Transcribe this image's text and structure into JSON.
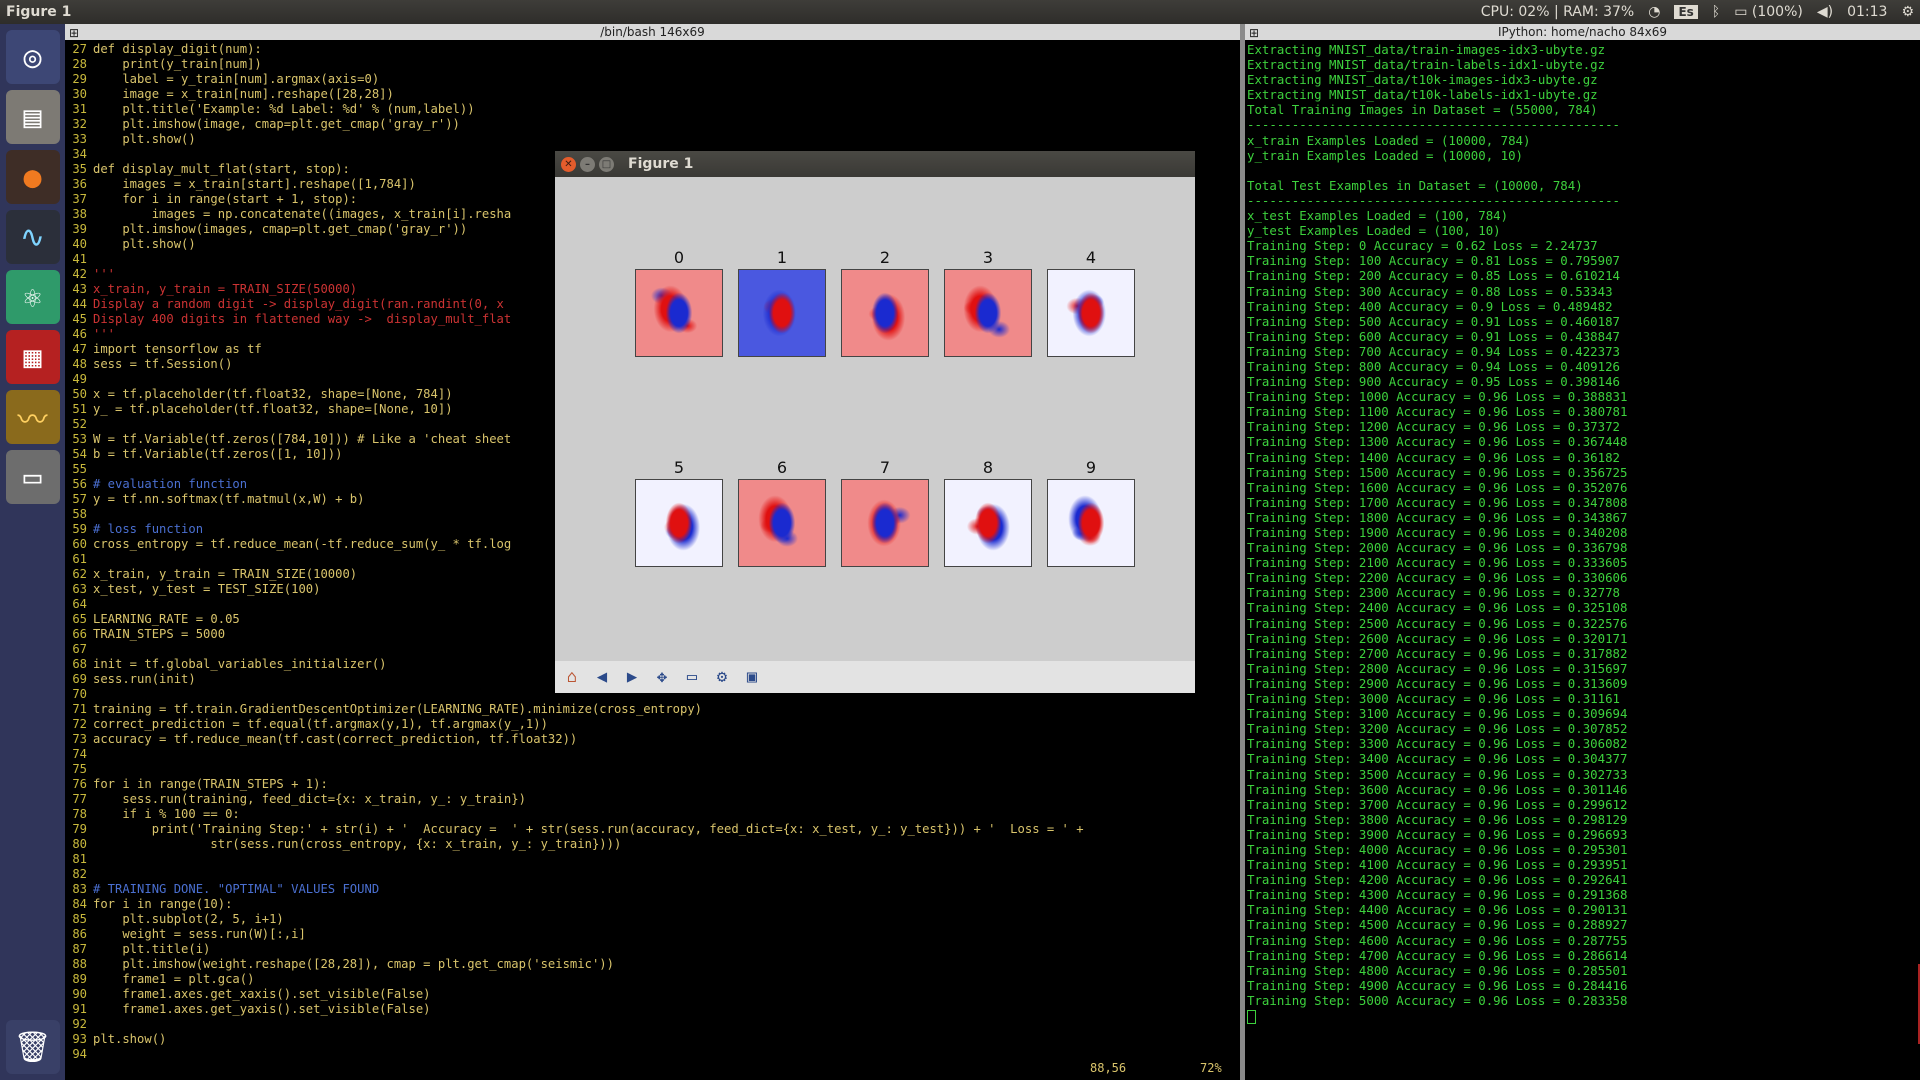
{
  "topbar": {
    "app_title": "Figure 1",
    "cpu_ram": "CPU: 02% | RAM: 37%",
    "keyboard": "Es",
    "battery": "(100%)",
    "clock": "01:13"
  },
  "left_pane": {
    "title": "/bin/bash 146x69",
    "status_pos": "88,56",
    "status_pct": "72%"
  },
  "right_pane": {
    "title": "IPython: home/nacho 84x69"
  },
  "figure": {
    "title": "Figure 1",
    "digits": [
      "0",
      "1",
      "2",
      "3",
      "4",
      "5",
      "6",
      "7",
      "8",
      "9"
    ],
    "toolbar": [
      "home-icon",
      "back-icon",
      "forward-icon",
      "pan-icon",
      "zoom-icon",
      "configure-icon",
      "save-icon"
    ]
  },
  "code_lines": [
    {
      "n": "27",
      "t": "def display_digit(num):"
    },
    {
      "n": "28",
      "t": "    print(y_train[num])"
    },
    {
      "n": "29",
      "t": "    label = y_train[num].argmax(axis=0)"
    },
    {
      "n": "30",
      "t": "    image = x_train[num].reshape([28,28])"
    },
    {
      "n": "31",
      "t": "    plt.title('Example: %d Label: %d' % (num,label))"
    },
    {
      "n": "32",
      "t": "    plt.imshow(image, cmap=plt.get_cmap('gray_r'))"
    },
    {
      "n": "33",
      "t": "    plt.show()"
    },
    {
      "n": "34",
      "t": ""
    },
    {
      "n": "35",
      "t": "def display_mult_flat(start, stop):"
    },
    {
      "n": "36",
      "t": "    images = x_train[start].reshape([1,784])"
    },
    {
      "n": "37",
      "t": "    for i in range(start + 1, stop):"
    },
    {
      "n": "38",
      "t": "        images = np.concatenate((images, x_train[i].resha"
    },
    {
      "n": "39",
      "t": "    plt.imshow(images, cmap=plt.get_cmap('gray_r'))"
    },
    {
      "n": "40",
      "t": "    plt.show()"
    },
    {
      "n": "41",
      "t": ""
    },
    {
      "n": "42",
      "t": "'''"
    },
    {
      "n": "43",
      "t": "x_train, y_train = TRAIN_SIZE(50000)"
    },
    {
      "n": "44",
      "t": "Display a random digit -> display_digit(ran.randint(0, x"
    },
    {
      "n": "45",
      "t": "Display 400 digits in flattened way ->  display_mult_flat"
    },
    {
      "n": "46",
      "t": "'''"
    },
    {
      "n": "47",
      "t": "import tensorflow as tf"
    },
    {
      "n": "48",
      "t": "sess = tf.Session()"
    },
    {
      "n": "49",
      "t": ""
    },
    {
      "n": "50",
      "t": "x = tf.placeholder(tf.float32, shape=[None, 784])"
    },
    {
      "n": "51",
      "t": "y_ = tf.placeholder(tf.float32, shape=[None, 10])"
    },
    {
      "n": "52",
      "t": ""
    },
    {
      "n": "53",
      "t": "W = tf.Variable(tf.zeros([784,10])) # Like a 'cheat sheet"
    },
    {
      "n": "54",
      "t": "b = tf.Variable(tf.zeros([1, 10]))"
    },
    {
      "n": "55",
      "t": ""
    },
    {
      "n": "56",
      "t": "# evaluation function"
    },
    {
      "n": "57",
      "t": "y = tf.nn.softmax(tf.matmul(x,W) + b)"
    },
    {
      "n": "58",
      "t": ""
    },
    {
      "n": "59",
      "t": "# loss function"
    },
    {
      "n": "60",
      "t": "cross_entropy = tf.reduce_mean(-tf.reduce_sum(y_ * tf.log"
    },
    {
      "n": "61",
      "t": ""
    },
    {
      "n": "62",
      "t": "x_train, y_train = TRAIN_SIZE(10000)"
    },
    {
      "n": "63",
      "t": "x_test, y_test = TEST_SIZE(100)"
    },
    {
      "n": "64",
      "t": ""
    },
    {
      "n": "65",
      "t": "LEARNING_RATE = 0.05"
    },
    {
      "n": "66",
      "t": "TRAIN_STEPS = 5000"
    },
    {
      "n": "67",
      "t": ""
    },
    {
      "n": "68",
      "t": "init = tf.global_variables_initializer()"
    },
    {
      "n": "69",
      "t": "sess.run(init)"
    },
    {
      "n": "70",
      "t": ""
    },
    {
      "n": "71",
      "t": "training = tf.train.GradientDescentOptimizer(LEARNING_RATE).minimize(cross_entropy)"
    },
    {
      "n": "72",
      "t": "correct_prediction = tf.equal(tf.argmax(y,1), tf.argmax(y_,1))"
    },
    {
      "n": "73",
      "t": "accuracy = tf.reduce_mean(tf.cast(correct_prediction, tf.float32))"
    },
    {
      "n": "74",
      "t": ""
    },
    {
      "n": "75",
      "t": ""
    },
    {
      "n": "76",
      "t": "for i in range(TRAIN_STEPS + 1):"
    },
    {
      "n": "77",
      "t": "    sess.run(training, feed_dict={x: x_train, y_: y_train})"
    },
    {
      "n": "78",
      "t": "    if i % 100 == 0:"
    },
    {
      "n": "79",
      "t": "        print('Training Step:' + str(i) + '  Accuracy =  ' + str(sess.run(accuracy, feed_dict={x: x_test, y_: y_test})) + '  Loss = ' +"
    },
    {
      "n": "80",
      "t": "                str(sess.run(cross_entropy, {x: x_train, y_: y_train})))"
    },
    {
      "n": "81",
      "t": ""
    },
    {
      "n": "82",
      "t": ""
    },
    {
      "n": "83",
      "t": "# TRAINING DONE. \"OPTIMAL\" VALUES FOUND"
    },
    {
      "n": "84",
      "t": "for i in range(10):"
    },
    {
      "n": "85",
      "t": "    plt.subplot(2, 5, i+1)"
    },
    {
      "n": "86",
      "t": "    weight = sess.run(W)[:,i]"
    },
    {
      "n": "87",
      "t": "    plt.title(i)"
    },
    {
      "n": "88",
      "t": "    plt.imshow(weight.reshape([28,28]), cmap = plt.get_cmap('seismic'))"
    },
    {
      "n": "89",
      "t": "    frame1 = plt.gca()"
    },
    {
      "n": "90",
      "t": "    frame1.axes.get_xaxis().set_visible(False)"
    },
    {
      "n": "91",
      "t": "    frame1.axes.get_yaxis().set_visible(False)"
    },
    {
      "n": "92",
      "t": ""
    },
    {
      "n": "93",
      "t": "plt.show()"
    },
    {
      "n": "94",
      "t": ""
    }
  ],
  "terminal_lines": [
    "Extracting MNIST_data/train-images-idx3-ubyte.gz",
    "Extracting MNIST_data/train-labels-idx1-ubyte.gz",
    "Extracting MNIST_data/t10k-images-idx3-ubyte.gz",
    "Extracting MNIST_data/t10k-labels-idx1-ubyte.gz",
    "Total Training Images in Dataset = (55000, 784)",
    "--------------------------------------------------",
    "x_train Examples Loaded = (10000, 784)",
    "y_train Examples Loaded = (10000, 10)",
    "",
    "Total Test Examples in Dataset = (10000, 784)",
    "--------------------------------------------------",
    "x_test Examples Loaded = (100, 784)",
    "y_test Examples Loaded = (100, 10)",
    "Training Step: 0 Accuracy = 0.62 Loss = 2.24737",
    "Training Step: 100 Accuracy = 0.81 Loss = 0.795907",
    "Training Step: 200 Accuracy = 0.85 Loss = 0.610214",
    "Training Step: 300 Accuracy = 0.88 Loss = 0.53343",
    "Training Step: 400 Accuracy = 0.9 Loss = 0.489482",
    "Training Step: 500 Accuracy = 0.91 Loss = 0.460187",
    "Training Step: 600 Accuracy = 0.91 Loss = 0.438847",
    "Training Step: 700 Accuracy = 0.94 Loss = 0.422373",
    "Training Step: 800 Accuracy = 0.94 Loss = 0.409126",
    "Training Step: 900 Accuracy = 0.95 Loss = 0.398146",
    "Training Step: 1000 Accuracy = 0.96 Loss = 0.388831",
    "Training Step: 1100 Accuracy = 0.96 Loss = 0.380781",
    "Training Step: 1200 Accuracy = 0.96 Loss = 0.37372",
    "Training Step: 1300 Accuracy = 0.96 Loss = 0.367448",
    "Training Step: 1400 Accuracy = 0.96 Loss = 0.36182",
    "Training Step: 1500 Accuracy = 0.96 Loss = 0.356725",
    "Training Step: 1600 Accuracy = 0.96 Loss = 0.352076",
    "Training Step: 1700 Accuracy = 0.96 Loss = 0.347808",
    "Training Step: 1800 Accuracy = 0.96 Loss = 0.343867",
    "Training Step: 1900 Accuracy = 0.96 Loss = 0.340208",
    "Training Step: 2000 Accuracy = 0.96 Loss = 0.336798",
    "Training Step: 2100 Accuracy = 0.96 Loss = 0.333605",
    "Training Step: 2200 Accuracy = 0.96 Loss = 0.330606",
    "Training Step: 2300 Accuracy = 0.96 Loss = 0.32778",
    "Training Step: 2400 Accuracy = 0.96 Loss = 0.325108",
    "Training Step: 2500 Accuracy = 0.96 Loss = 0.322576",
    "Training Step: 2600 Accuracy = 0.96 Loss = 0.320171",
    "Training Step: 2700 Accuracy = 0.96 Loss = 0.317882",
    "Training Step: 2800 Accuracy = 0.96 Loss = 0.315697",
    "Training Step: 2900 Accuracy = 0.96 Loss = 0.313609",
    "Training Step: 3000 Accuracy = 0.96 Loss = 0.31161",
    "Training Step: 3100 Accuracy = 0.96 Loss = 0.309694",
    "Training Step: 3200 Accuracy = 0.96 Loss = 0.307852",
    "Training Step: 3300 Accuracy = 0.96 Loss = 0.306082",
    "Training Step: 3400 Accuracy = 0.96 Loss = 0.304377",
    "Training Step: 3500 Accuracy = 0.96 Loss = 0.302733",
    "Training Step: 3600 Accuracy = 0.96 Loss = 0.301146",
    "Training Step: 3700 Accuracy = 0.96 Loss = 0.299612",
    "Training Step: 3800 Accuracy = 0.96 Loss = 0.298129",
    "Training Step: 3900 Accuracy = 0.96 Loss = 0.296693",
    "Training Step: 4000 Accuracy = 0.96 Loss = 0.295301",
    "Training Step: 4100 Accuracy = 0.96 Loss = 0.293951",
    "Training Step: 4200 Accuracy = 0.96 Loss = 0.292641",
    "Training Step: 4300 Accuracy = 0.96 Loss = 0.291368",
    "Training Step: 4400 Accuracy = 0.96 Loss = 0.290131",
    "Training Step: 4500 Accuracy = 0.96 Loss = 0.288927",
    "Training Step: 4600 Accuracy = 0.96 Loss = 0.287755",
    "Training Step: 4700 Accuracy = 0.96 Loss = 0.286614",
    "Training Step: 4800 Accuracy = 0.96 Loss = 0.285501",
    "Training Step: 4900 Accuracy = 0.96 Loss = 0.284416",
    "Training Step: 5000 Accuracy = 0.96 Loss = 0.283358"
  ],
  "colors": {
    "terminal_green": "#3dd13d",
    "seismic_red": "#e01010",
    "seismic_blue": "#1a2ad0",
    "launcher_bg": "#30355a"
  }
}
